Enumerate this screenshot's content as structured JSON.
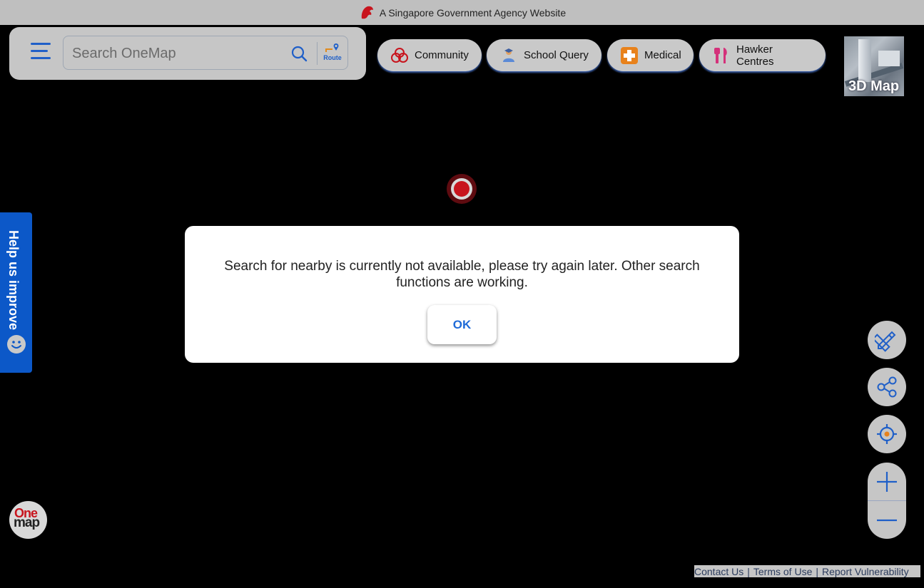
{
  "banner": {
    "text": "A Singapore Government Agency Website",
    "icon": "lion-head-icon"
  },
  "search": {
    "placeholder": "Search OneMap",
    "value": "",
    "route_label": "Route"
  },
  "quick_links": [
    {
      "label": "Community",
      "icon": "community-icon"
    },
    {
      "label": "School Query",
      "icon": "school-icon"
    },
    {
      "label": "Medical",
      "icon": "medical-cross-icon"
    },
    {
      "label": "Hawker Centres",
      "icon": "fork-knife-icon"
    }
  ],
  "map3d": {
    "label": "3D Map"
  },
  "help": {
    "label": "Help us improve"
  },
  "modal": {
    "message": "Search for nearby is currently not available, please try again later. Other search functions are working.",
    "ok_label": "OK"
  },
  "logo": {
    "line1": "One",
    "line2": "map"
  },
  "footer": {
    "links": [
      "Contact Us",
      "Terms of Use",
      "Report Vulnerability"
    ],
    "separator": "|"
  },
  "colors": {
    "accent": "#1f5fc8",
    "help_tab": "#0c58c8",
    "brand_red": "#c8141d"
  }
}
